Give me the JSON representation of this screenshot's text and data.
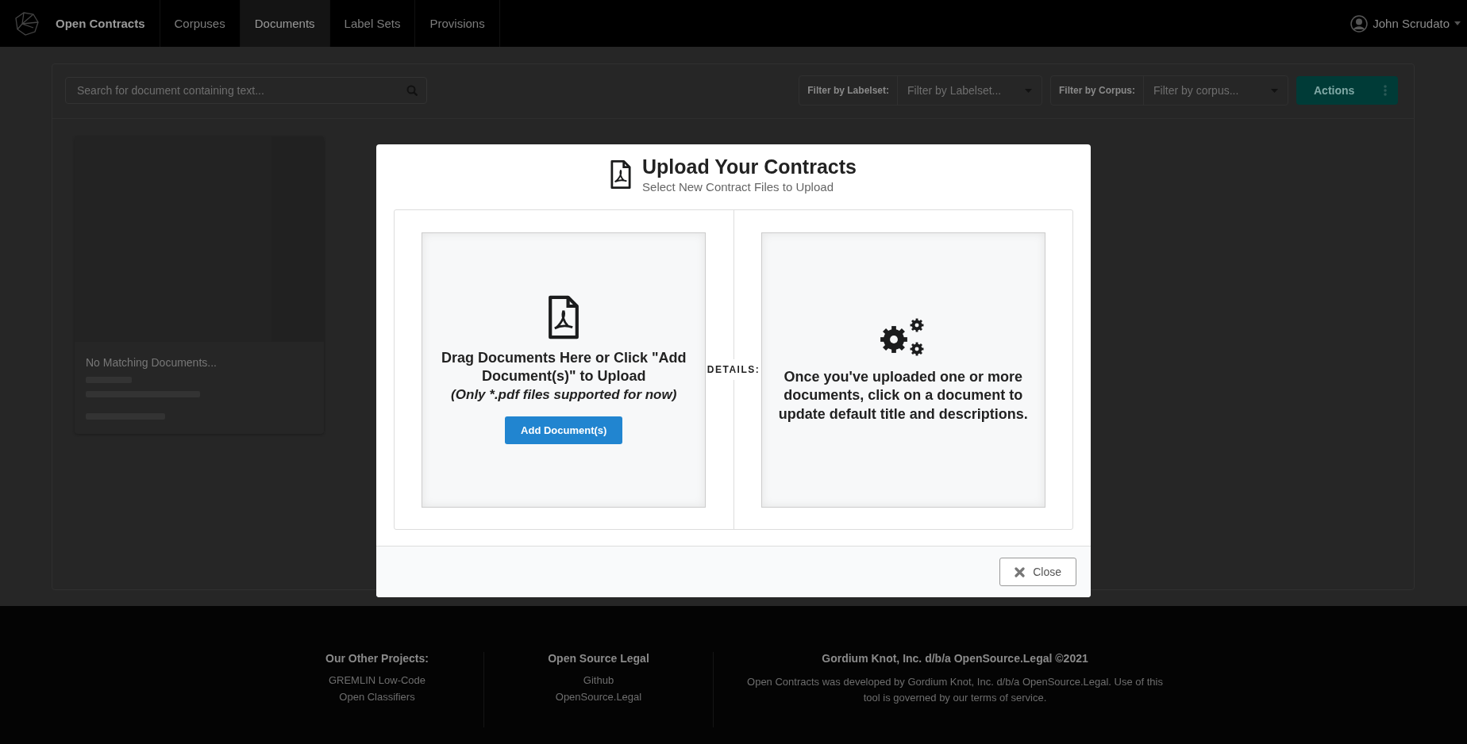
{
  "nav": {
    "brand": "Open Contracts",
    "items": [
      {
        "label": "Corpuses",
        "selected": false
      },
      {
        "label": "Documents",
        "selected": true
      },
      {
        "label": "Label Sets",
        "selected": false
      },
      {
        "label": "Provisions",
        "selected": false
      }
    ],
    "user": "John Scrudato"
  },
  "toolbar": {
    "search": {
      "placeholder": "Search for document containing text..."
    },
    "filters": [
      {
        "label": "Filter by Labelset:",
        "placeholder": "Filter by Labelset..."
      },
      {
        "label": "Filter by Corpus:",
        "placeholder": "Filter by corpus..."
      }
    ],
    "actions_button": "Actions"
  },
  "card": {
    "title": "No Matching Documents..."
  },
  "footer": {
    "columns": [
      {
        "heading": "Our Other Projects:",
        "links": [
          "GREMLIN Low-Code",
          "Open Classifiers"
        ]
      },
      {
        "heading": "Open Source Legal",
        "links": [
          "Github",
          "OpenSource.Legal"
        ]
      },
      {
        "heading": "Gordium Knot, Inc. d/b/a OpenSource.Legal ©2021",
        "text": "Open Contracts was developed by Gordium Knot, Inc. d/b/a OpenSource.Legal. Use of this tool is governed by our terms of service."
      }
    ]
  },
  "modal": {
    "title": "Upload Your Contracts",
    "subtitle": "Select New Contract Files to Upload",
    "dropzone": {
      "text": "Drag Documents Here or Click \"Add Document(s)\" to Upload",
      "note": "(Only *.pdf files supported for now)",
      "button": "Add Document(s)"
    },
    "divider": "DETAILS:",
    "details": "Once you've uploaded one or more documents, click on a document to update default title and descriptions.",
    "close_button": "Close"
  }
}
